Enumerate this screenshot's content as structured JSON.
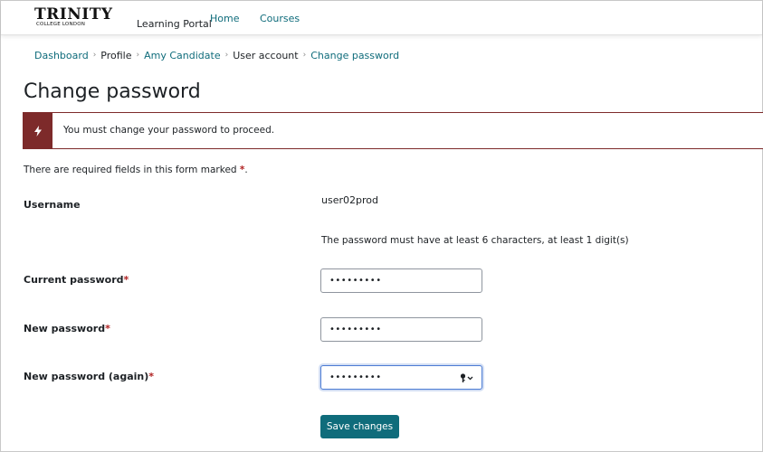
{
  "header": {
    "logo_main": "TRINITY",
    "logo_sub": "COLLEGE LONDON",
    "portal_name": "Learning Portal",
    "nav": [
      {
        "label": "Home"
      },
      {
        "label": "Courses"
      }
    ]
  },
  "breadcrumb": [
    {
      "label": "Dashboard",
      "link": true
    },
    {
      "label": "Profile",
      "link": false
    },
    {
      "label": "Amy Candidate",
      "link": true
    },
    {
      "label": "User account",
      "link": false
    },
    {
      "label": "Change password",
      "link": true
    }
  ],
  "page_title": "Change password",
  "alert": {
    "message": "You must change your password to proceed.",
    "icon": "lightning-bolt-icon",
    "color": "#7d2a2a"
  },
  "required_note": {
    "text": "There are required fields in this form marked",
    "star": "*",
    "end": "."
  },
  "form": {
    "username_label": "Username",
    "username_value": "user02prod",
    "password_rule": "The password must have at least 6 characters, at least 1 digit(s)",
    "current_password_label": "Current password",
    "current_password_value": "•••••••••",
    "new_password_label": "New password",
    "new_password_value": "•••••••••",
    "new_password_again_label": "New password (again)",
    "new_password_again_value": "•••••••••",
    "required_star": "*",
    "save_label": "Save changes"
  },
  "colors": {
    "accent": "#0f6c7b",
    "danger": "#7d2a2a",
    "required": "#b02020"
  }
}
